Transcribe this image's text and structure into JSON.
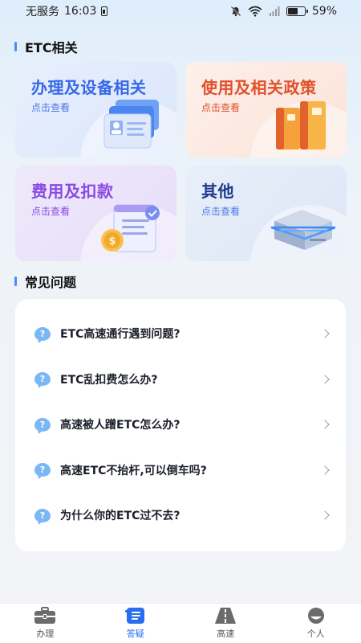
{
  "status_bar": {
    "carrier": "无服务",
    "time": "16:03",
    "battery": "59%",
    "battery_level": 0.59
  },
  "etc_section": {
    "title": "ETC相关",
    "cards": [
      {
        "title": "办理及设备相关",
        "sub": "点击查看",
        "icon": "id-card-icon"
      },
      {
        "title": "使用及相关政策",
        "sub": "点击查看",
        "icon": "folders-icon"
      },
      {
        "title": "费用及扣款",
        "sub": "点击查看",
        "icon": "bill-coin-icon"
      },
      {
        "title": "其他",
        "sub": "点击查看",
        "icon": "device-box-icon"
      }
    ]
  },
  "faq_section": {
    "title": "常见问题",
    "items": [
      "ETC高速通行遇到问题?",
      "ETC乱扣费怎么办?",
      "高速被人蹭ETC怎么办?",
      "高速ETC不抬杆,可以倒车吗?",
      "为什么你的ETC过不去?"
    ],
    "item_icon": "question-bubble-icon"
  },
  "tab_bar": {
    "tabs": [
      {
        "label": "办理",
        "icon": "briefcase-icon"
      },
      {
        "label": "答疑",
        "icon": "doc-list-icon",
        "active": true
      },
      {
        "label": "高速",
        "icon": "highway-icon"
      },
      {
        "label": "个人",
        "icon": "profile-icon"
      }
    ]
  },
  "colors": {
    "accent": "#2a6df0",
    "faq_icon": "#7ab7f5"
  }
}
